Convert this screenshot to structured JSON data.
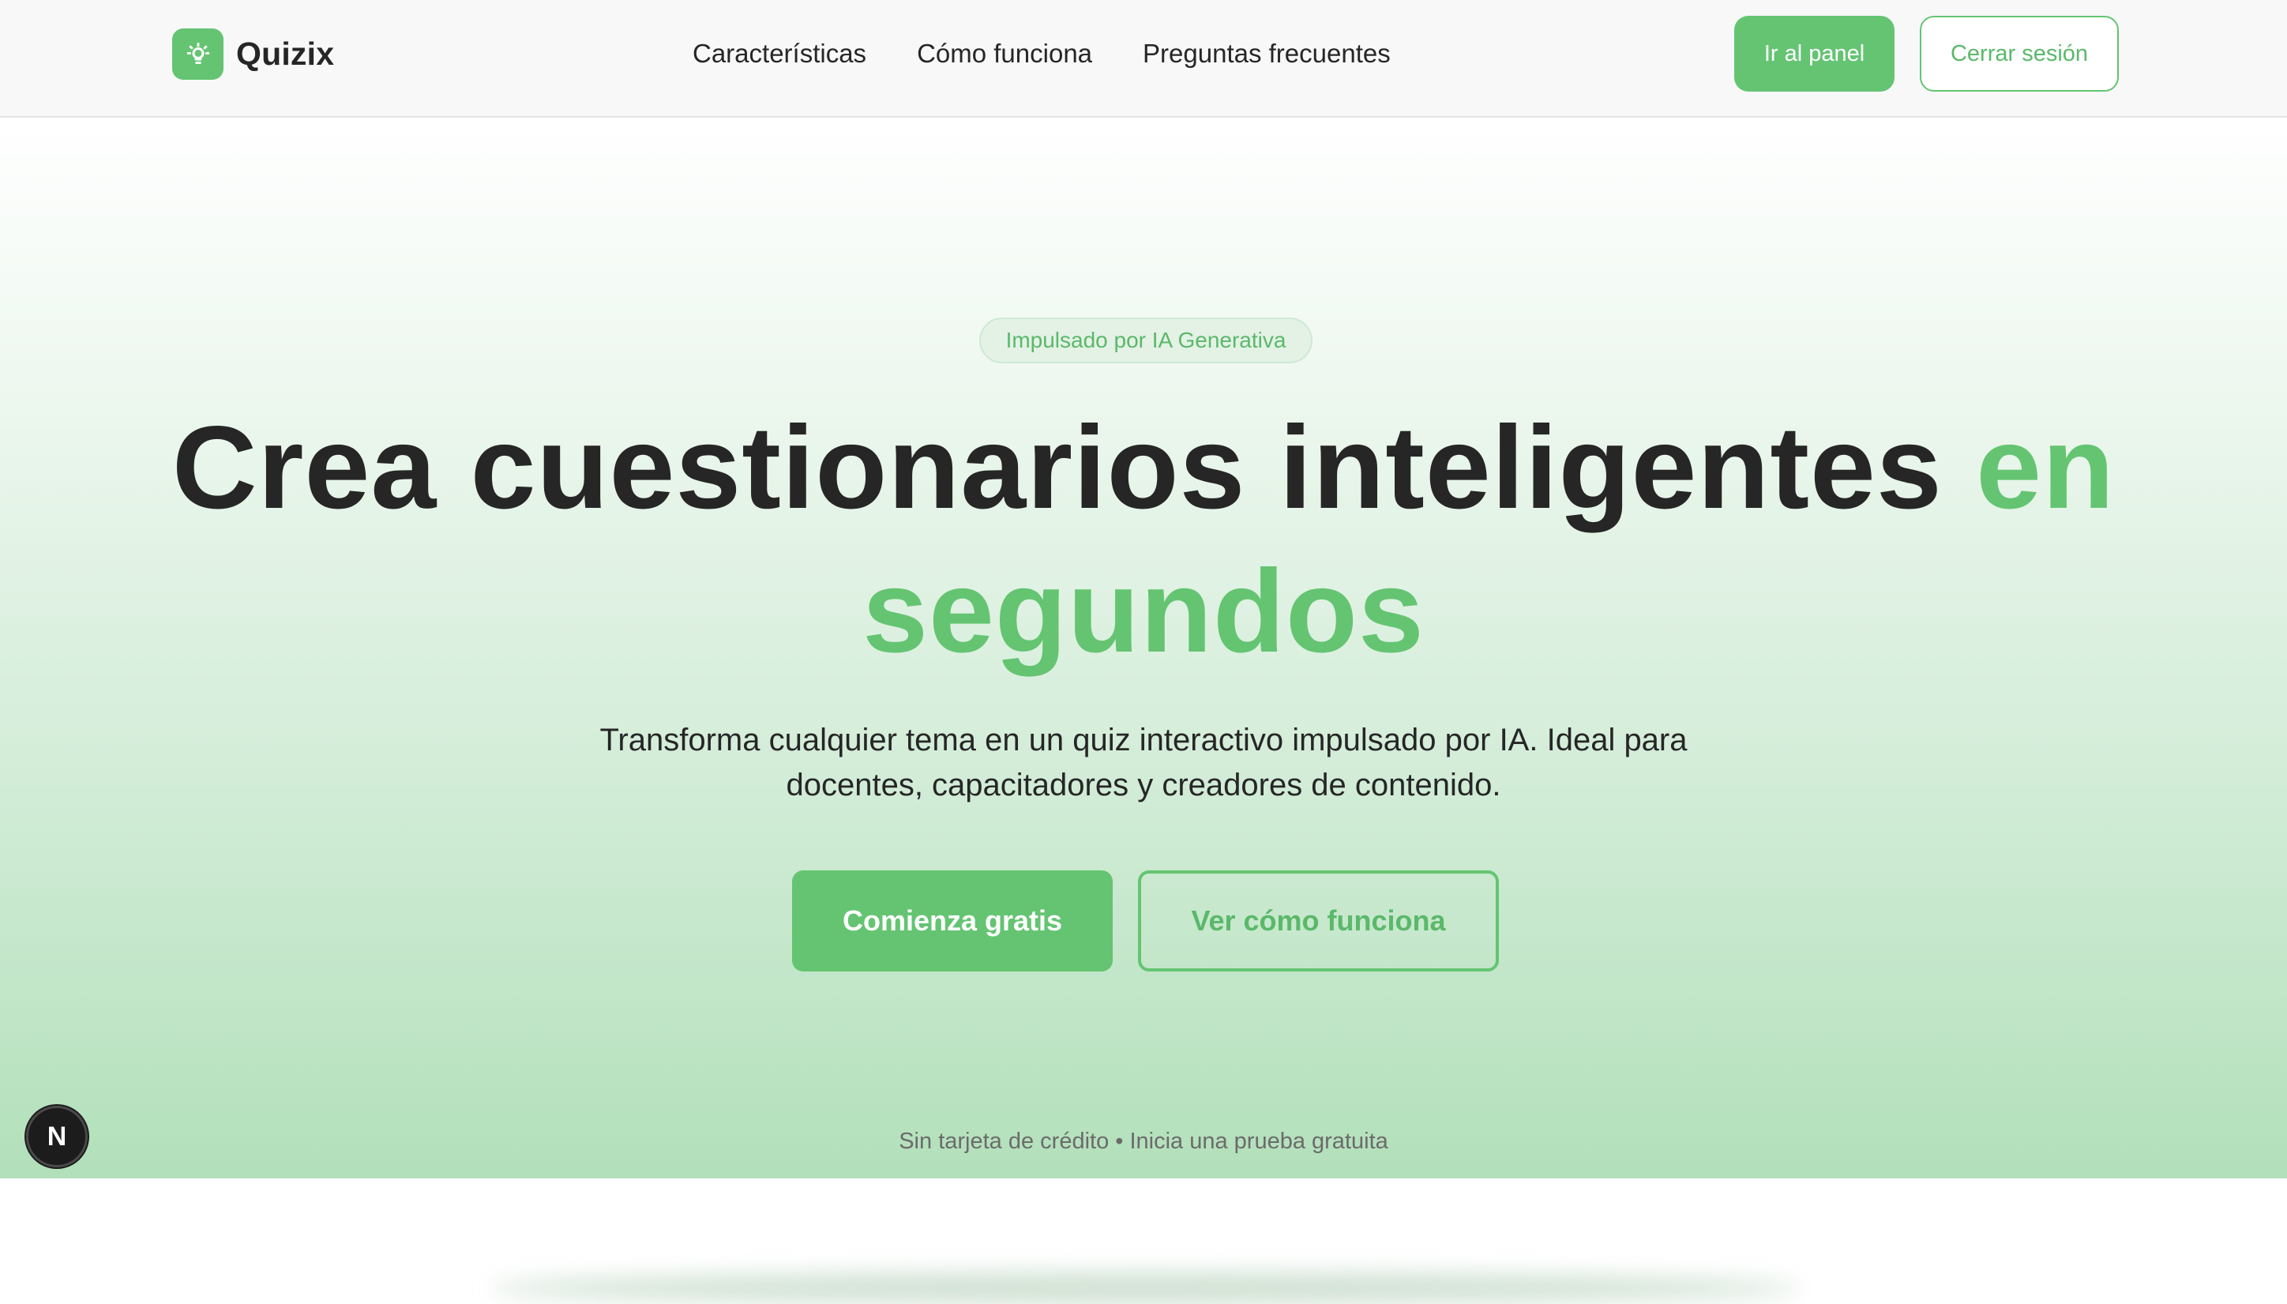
{
  "colors": {
    "accent": "#64c472",
    "text": "#262626",
    "muted": "#6b6b6b",
    "header_bg": "#f8f8f8"
  },
  "header": {
    "brand": {
      "logo_icon": "lightbulb-icon",
      "name": "Quizix"
    },
    "nav": [
      {
        "label": "Características"
      },
      {
        "label": "Cómo funciona"
      },
      {
        "label": "Preguntas frecuentes"
      }
    ],
    "panel_button": "Ir al panel",
    "logout_button": "Cerrar sesión"
  },
  "hero": {
    "badge": "Impulsado por IA Generativa",
    "headline_main": "Crea cuestionarios inteligentes",
    "headline_accent_1": "en",
    "headline_accent_2": "segundos",
    "subtitle": "Transforma cualquier tema en un quiz interactivo impulsado por IA. Ideal para docentes, capacitadores y creadores de contenido.",
    "cta_primary": "Comienza gratis",
    "cta_secondary": "Ver cómo funciona",
    "note": "Sin tarjeta de crédito • Inicia una prueba gratuita"
  },
  "dev_indicator": {
    "icon": "nextjs-logo-icon",
    "label": "N"
  }
}
